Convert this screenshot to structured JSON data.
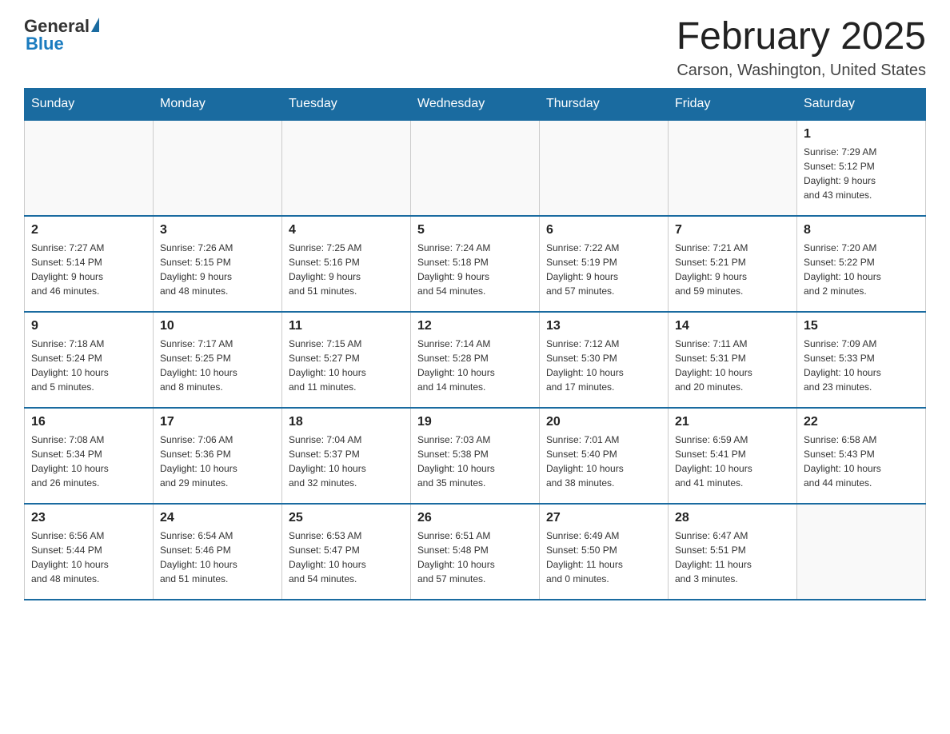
{
  "logo": {
    "general": "General",
    "blue": "Blue"
  },
  "title": "February 2025",
  "subtitle": "Carson, Washington, United States",
  "days_header": [
    "Sunday",
    "Monday",
    "Tuesday",
    "Wednesday",
    "Thursday",
    "Friday",
    "Saturday"
  ],
  "weeks": [
    [
      {
        "day": "",
        "info": ""
      },
      {
        "day": "",
        "info": ""
      },
      {
        "day": "",
        "info": ""
      },
      {
        "day": "",
        "info": ""
      },
      {
        "day": "",
        "info": ""
      },
      {
        "day": "",
        "info": ""
      },
      {
        "day": "1",
        "info": "Sunrise: 7:29 AM\nSunset: 5:12 PM\nDaylight: 9 hours\nand 43 minutes."
      }
    ],
    [
      {
        "day": "2",
        "info": "Sunrise: 7:27 AM\nSunset: 5:14 PM\nDaylight: 9 hours\nand 46 minutes."
      },
      {
        "day": "3",
        "info": "Sunrise: 7:26 AM\nSunset: 5:15 PM\nDaylight: 9 hours\nand 48 minutes."
      },
      {
        "day": "4",
        "info": "Sunrise: 7:25 AM\nSunset: 5:16 PM\nDaylight: 9 hours\nand 51 minutes."
      },
      {
        "day": "5",
        "info": "Sunrise: 7:24 AM\nSunset: 5:18 PM\nDaylight: 9 hours\nand 54 minutes."
      },
      {
        "day": "6",
        "info": "Sunrise: 7:22 AM\nSunset: 5:19 PM\nDaylight: 9 hours\nand 57 minutes."
      },
      {
        "day": "7",
        "info": "Sunrise: 7:21 AM\nSunset: 5:21 PM\nDaylight: 9 hours\nand 59 minutes."
      },
      {
        "day": "8",
        "info": "Sunrise: 7:20 AM\nSunset: 5:22 PM\nDaylight: 10 hours\nand 2 minutes."
      }
    ],
    [
      {
        "day": "9",
        "info": "Sunrise: 7:18 AM\nSunset: 5:24 PM\nDaylight: 10 hours\nand 5 minutes."
      },
      {
        "day": "10",
        "info": "Sunrise: 7:17 AM\nSunset: 5:25 PM\nDaylight: 10 hours\nand 8 minutes."
      },
      {
        "day": "11",
        "info": "Sunrise: 7:15 AM\nSunset: 5:27 PM\nDaylight: 10 hours\nand 11 minutes."
      },
      {
        "day": "12",
        "info": "Sunrise: 7:14 AM\nSunset: 5:28 PM\nDaylight: 10 hours\nand 14 minutes."
      },
      {
        "day": "13",
        "info": "Sunrise: 7:12 AM\nSunset: 5:30 PM\nDaylight: 10 hours\nand 17 minutes."
      },
      {
        "day": "14",
        "info": "Sunrise: 7:11 AM\nSunset: 5:31 PM\nDaylight: 10 hours\nand 20 minutes."
      },
      {
        "day": "15",
        "info": "Sunrise: 7:09 AM\nSunset: 5:33 PM\nDaylight: 10 hours\nand 23 minutes."
      }
    ],
    [
      {
        "day": "16",
        "info": "Sunrise: 7:08 AM\nSunset: 5:34 PM\nDaylight: 10 hours\nand 26 minutes."
      },
      {
        "day": "17",
        "info": "Sunrise: 7:06 AM\nSunset: 5:36 PM\nDaylight: 10 hours\nand 29 minutes."
      },
      {
        "day": "18",
        "info": "Sunrise: 7:04 AM\nSunset: 5:37 PM\nDaylight: 10 hours\nand 32 minutes."
      },
      {
        "day": "19",
        "info": "Sunrise: 7:03 AM\nSunset: 5:38 PM\nDaylight: 10 hours\nand 35 minutes."
      },
      {
        "day": "20",
        "info": "Sunrise: 7:01 AM\nSunset: 5:40 PM\nDaylight: 10 hours\nand 38 minutes."
      },
      {
        "day": "21",
        "info": "Sunrise: 6:59 AM\nSunset: 5:41 PM\nDaylight: 10 hours\nand 41 minutes."
      },
      {
        "day": "22",
        "info": "Sunrise: 6:58 AM\nSunset: 5:43 PM\nDaylight: 10 hours\nand 44 minutes."
      }
    ],
    [
      {
        "day": "23",
        "info": "Sunrise: 6:56 AM\nSunset: 5:44 PM\nDaylight: 10 hours\nand 48 minutes."
      },
      {
        "day": "24",
        "info": "Sunrise: 6:54 AM\nSunset: 5:46 PM\nDaylight: 10 hours\nand 51 minutes."
      },
      {
        "day": "25",
        "info": "Sunrise: 6:53 AM\nSunset: 5:47 PM\nDaylight: 10 hours\nand 54 minutes."
      },
      {
        "day": "26",
        "info": "Sunrise: 6:51 AM\nSunset: 5:48 PM\nDaylight: 10 hours\nand 57 minutes."
      },
      {
        "day": "27",
        "info": "Sunrise: 6:49 AM\nSunset: 5:50 PM\nDaylight: 11 hours\nand 0 minutes."
      },
      {
        "day": "28",
        "info": "Sunrise: 6:47 AM\nSunset: 5:51 PM\nDaylight: 11 hours\nand 3 minutes."
      },
      {
        "day": "",
        "info": ""
      }
    ]
  ]
}
